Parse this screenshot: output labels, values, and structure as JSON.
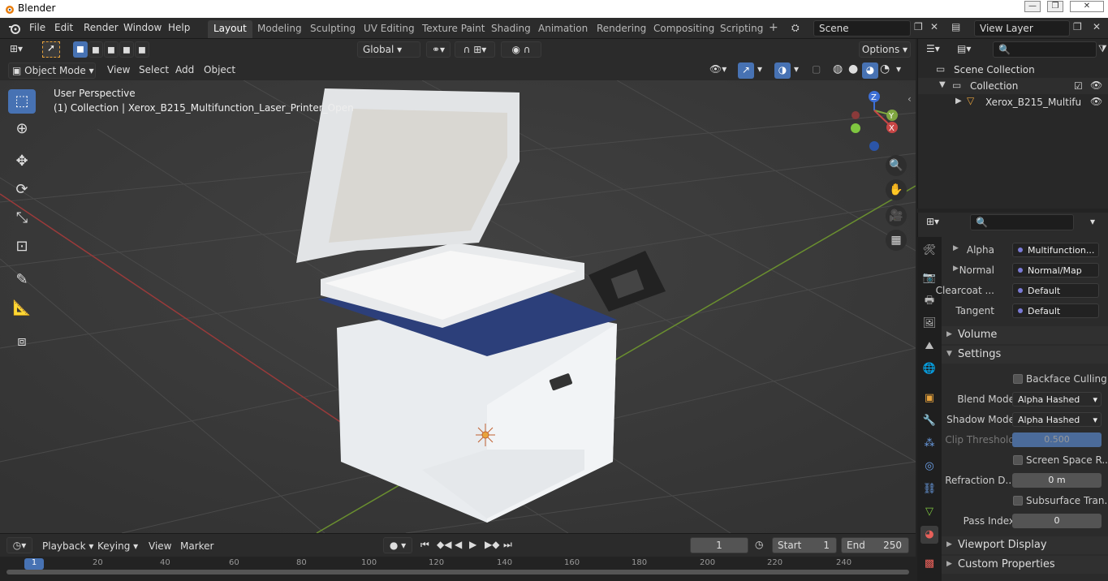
{
  "app": {
    "title": "Blender"
  },
  "window_controls": [
    "—",
    "❐",
    "✕"
  ],
  "menu": [
    "File",
    "Edit",
    "Render",
    "Window",
    "Help"
  ],
  "workspace_tabs": [
    "Layout",
    "Modeling",
    "Sculpting",
    "UV Editing",
    "Texture Paint",
    "Shading",
    "Animation",
    "Rendering",
    "Compositing",
    "Scripting"
  ],
  "add_tab": "+",
  "scene": {
    "name": "Scene"
  },
  "view_layer": {
    "name": "View Layer"
  },
  "header": {
    "transform_orientation": "Global",
    "options": "Options",
    "mode": "Object Mode",
    "menus": [
      "View",
      "Select",
      "Add",
      "Object"
    ]
  },
  "viewport": {
    "perspective": "User Perspective",
    "collection_info": "(1) Collection | Xerox_B215_Multifunction_Laser_Printer_Open"
  },
  "gizmo": {
    "z": "Z",
    "y": "Y",
    "x": "X"
  },
  "outliner": {
    "root": "Scene Collection",
    "collection": "Collection",
    "object": "Xerox_B215_Multifu"
  },
  "properties": {
    "rows_top": [
      {
        "label": "Alpha",
        "value": "Multifunction..."
      },
      {
        "label": "Normal",
        "value": "Normal/Map"
      },
      {
        "label": "Clearcoat ...",
        "value": "Default"
      },
      {
        "label": "Tangent",
        "value": "Default"
      }
    ],
    "volume": "Volume",
    "settings": "Settings",
    "backface": "Backface Culling",
    "blend_label": "Blend Mode",
    "blend_value": "Alpha Hashed",
    "shadow_label": "Shadow Mode",
    "shadow_value": "Alpha Hashed",
    "clip_label": "Clip Threshold",
    "clip_value": "0.500",
    "ssr": "Screen Space R...",
    "refraction_label": "Refraction D...",
    "refraction_value": "0 m",
    "subsurface": "Subsurface Tran...",
    "pass_label": "Pass Index",
    "pass_value": "0",
    "viewport_display": "Viewport Display",
    "custom_props": "Custom Properties"
  },
  "timeline": {
    "menus": [
      "Playback",
      "Keying",
      "View",
      "Marker"
    ],
    "current_frame": "1",
    "start_label": "Start",
    "start": "1",
    "end_label": "End",
    "end": "250",
    "ruler": [
      "1",
      "20",
      "40",
      "60",
      "80",
      "100",
      "120",
      "140",
      "160",
      "180",
      "200",
      "220",
      "240"
    ]
  },
  "colors": {
    "accent": "#4772b3",
    "x_axis": "#c84646",
    "y_axis": "#7fa640",
    "z_axis": "#3d6fd6"
  }
}
